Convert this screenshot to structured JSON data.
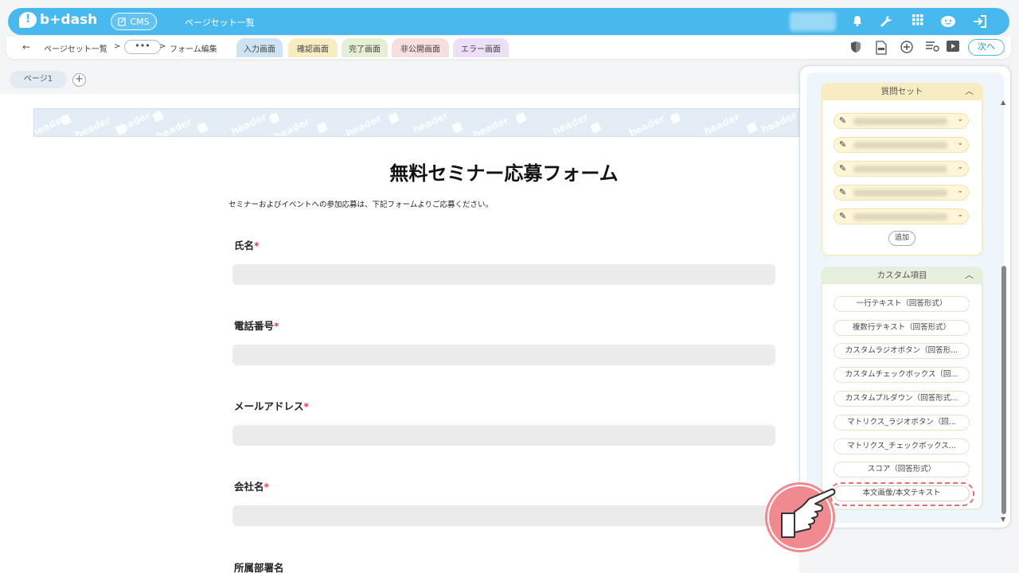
{
  "app": {
    "logo_text": "b+dash",
    "cms_label": "CMS",
    "top_title": "ページセット一覧",
    "brand_color": "#47b9ef"
  },
  "topbar_icons": [
    "bell-icon",
    "wrench-icon",
    "grid-icon",
    "face-icon",
    "logout-icon"
  ],
  "breadcrumb": {
    "back_icon": "←",
    "item1": "ページセット一覧",
    "sep": ">",
    "ellipsis": "•••",
    "item2": "フォーム編集"
  },
  "tabs": [
    {
      "label": "入力画面",
      "color": "#cfe4f3"
    },
    {
      "label": "確認画面",
      "color": "#f8edc0"
    },
    {
      "label": "完了画面",
      "color": "#e4efd4"
    },
    {
      "label": "非公開画面",
      "color": "#f8dede"
    },
    {
      "label": "エラー画面",
      "color": "#ecdff6"
    }
  ],
  "toolbar_icons": [
    "shield-icon",
    "html-file-icon",
    "add-circle-icon",
    "list-settings-icon",
    "play-icon"
  ],
  "next_label": "次へ",
  "pages": {
    "page1": "ページ1",
    "add": "+"
  },
  "header_placeholder": "header",
  "form": {
    "title": "無料セミナー応募フォーム",
    "description": "セミナーおよびイベントへの参加応募は、下記フォームよりご応募ください。",
    "required_mark": "*",
    "fields": [
      {
        "label": "氏名",
        "required": true
      },
      {
        "label": "電話番号",
        "required": true
      },
      {
        "label": "メールアドレス",
        "required": true
      },
      {
        "label": "会社名",
        "required": true
      },
      {
        "label": "所属部署名",
        "required": false
      }
    ]
  },
  "panel": {
    "question_set": {
      "title": "質問セット",
      "chevron": "︿",
      "item_count": 5,
      "add_label": "追加"
    },
    "custom_items": {
      "title": "カスタム項目",
      "chevron": "︿",
      "items": [
        "一行テキスト（回答形式）",
        "複数行テキスト（回答形式）",
        "カスタムラジオボタン（回答形...",
        "カスタムチェックボックス（回...",
        "カスタムプルダウン（回答形式...",
        "マトリクス_ラジオボタン（回...",
        "マトリクス_チェックボックス...",
        "スコア（回答形式）",
        "本文画像/本文テキスト"
      ]
    }
  }
}
